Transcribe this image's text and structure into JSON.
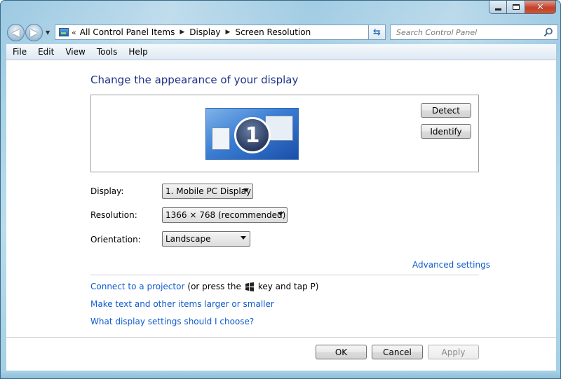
{
  "window": {
    "minimize_glyph": "minimize-icon",
    "maximize_glyph": "maximize-icon",
    "close_glyph": "✕"
  },
  "nav": {
    "back_icon": "back-arrow-icon",
    "forward_icon": "forward-arrow-icon",
    "breadcrumb": [
      "All Control Panel Items",
      "Display",
      "Screen Resolution"
    ],
    "search_placeholder": "Search Control Panel"
  },
  "menu": [
    "File",
    "Edit",
    "View",
    "Tools",
    "Help"
  ],
  "main": {
    "heading": "Change the appearance of your display",
    "monitor_number": "1",
    "detect_label": "Detect",
    "identify_label": "Identify",
    "display_label": "Display:",
    "display_value": "1. Mobile PC Display",
    "resolution_label": "Resolution:",
    "resolution_value": "1366 × 768 (recommended)",
    "orientation_label": "Orientation:",
    "orientation_value": "Landscape",
    "advanced_link": "Advanced settings",
    "projector_link": "Connect to a projector",
    "projector_note_prefix": "(or press the",
    "projector_note_suffix": "key and tap P)",
    "larger_link": "Make text and other items larger or smaller",
    "help_link": "What display settings should I choose?"
  },
  "buttons": {
    "ok": "OK",
    "cancel": "Cancel",
    "apply": "Apply"
  },
  "colors": {
    "link": "#0f5bcc",
    "heading": "#1e3287",
    "frame": "#9cc9e2"
  }
}
